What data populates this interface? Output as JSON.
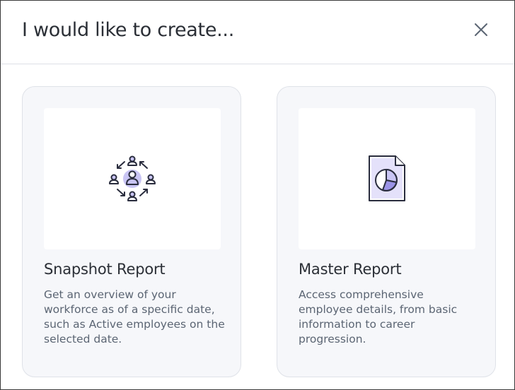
{
  "dialog": {
    "title": "I would like to create...",
    "close_icon": "close-icon"
  },
  "cards": [
    {
      "icon": "people-network-icon",
      "title": "Snapshot Report",
      "description": "Get an overview of your workforce as of a specific date, such as Active employees on the selected date."
    },
    {
      "icon": "pie-chart-document-icon",
      "title": "Master Report",
      "description": "Access comprehensive employee details, from basic information to career progression."
    }
  ],
  "colors": {
    "accent": "#c9c5f4",
    "icon_stroke": "#2a2d3e",
    "card_background": "#f6f7fa",
    "text_primary": "#2b2f36",
    "text_secondary": "#5b6573"
  }
}
